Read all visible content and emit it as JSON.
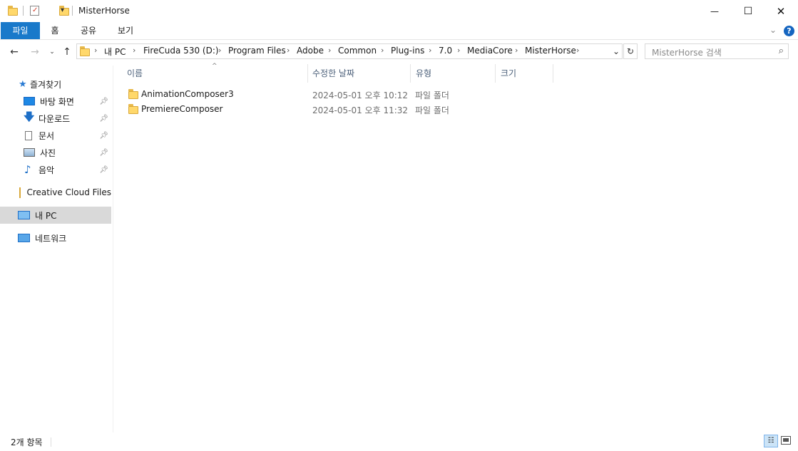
{
  "window": {
    "title": "MisterHorse",
    "controls": {
      "minimize": "—",
      "maximize": "☐",
      "close": "✕"
    }
  },
  "ribbon": {
    "tabs": [
      {
        "label": "파일",
        "active": true
      },
      {
        "label": "홈"
      },
      {
        "label": "공유"
      },
      {
        "label": "보기"
      }
    ],
    "expand_icon": "chevron-down-icon",
    "help_icon": "help-icon",
    "help_label": "?"
  },
  "address": {
    "breadcrumbs": [
      "내 PC",
      "FireCuda 530 (D:)",
      "Program Files",
      "Adobe",
      "Common",
      "Plug-ins",
      "7.0",
      "MediaCore",
      "MisterHorse"
    ],
    "search_placeholder": "MisterHorse 검색"
  },
  "nav": {
    "quick_access": "즐겨찾기",
    "pinned": [
      {
        "label": "바탕 화면",
        "icon": "desktop-icon"
      },
      {
        "label": "다운로드",
        "icon": "download-icon"
      },
      {
        "label": "문서",
        "icon": "document-icon"
      },
      {
        "label": "사진",
        "icon": "pictures-icon"
      },
      {
        "label": "음악",
        "icon": "music-icon"
      }
    ],
    "creative_cloud": "Creative Cloud Files",
    "this_pc": "내 PC",
    "network": "네트워크"
  },
  "columns": {
    "name": "이름",
    "modified": "수정한 날짜",
    "type": "유형",
    "size": "크기"
  },
  "files": [
    {
      "name": "AnimationComposer3",
      "modified": "2024-05-01 오후 10:12",
      "type": "파일 폴더"
    },
    {
      "name": "PremiereComposer",
      "modified": "2024-05-01 오후 11:32",
      "type": "파일 폴더"
    }
  ],
  "status": {
    "item_count": "2개 항목"
  },
  "colors": {
    "accent": "#1979ca",
    "selection": "#d9d9d9",
    "folder": "#ffd86b"
  }
}
